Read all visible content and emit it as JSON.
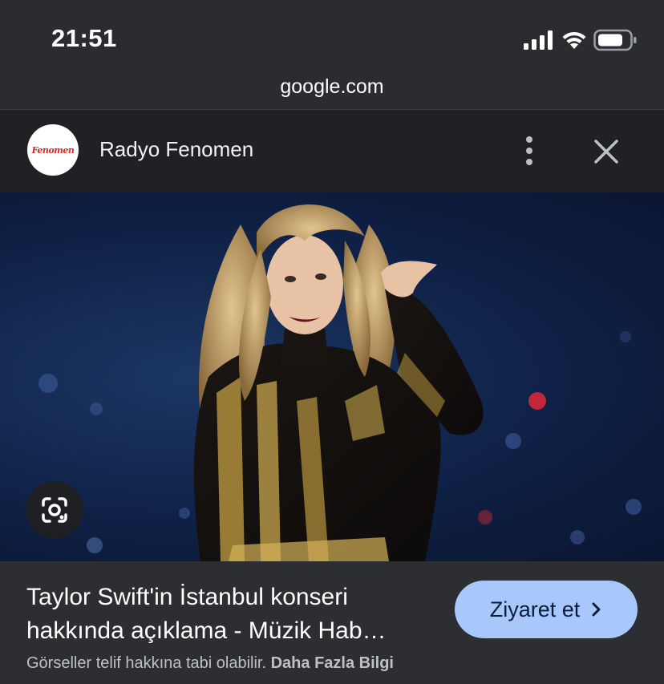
{
  "status_bar": {
    "time": "21:51",
    "icons": [
      "cellular-signal-icon",
      "wifi-icon",
      "battery-icon"
    ]
  },
  "browser": {
    "url": "google.com"
  },
  "source": {
    "name": "Radyo Fenomen",
    "logo_text": "Fenomen"
  },
  "result": {
    "title": "Taylor Swift'in İstanbul konseri hakkında açıklama - Müzik Hab…",
    "visit_label": "Ziyaret et",
    "copyright_text": "Görseller telif hakkına tabi olabilir.",
    "more_info_link": "Daha Fazla Bilgi"
  },
  "colors": {
    "background": "#202124",
    "info_panel": "#2d2e31",
    "visit_button": "#a8c7fa",
    "image_backdrop": "#0f2146"
  }
}
